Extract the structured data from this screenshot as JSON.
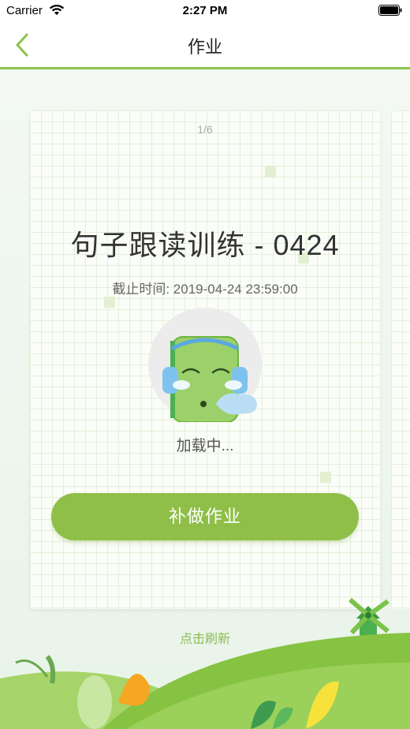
{
  "status_bar": {
    "carrier": "Carrier",
    "time": "2:27 PM"
  },
  "nav": {
    "title": "作业"
  },
  "card": {
    "page_indicator": "1/6",
    "title": "句子跟读训练 - 0424",
    "deadline": "截止时间: 2019-04-24 23:59:00",
    "loading_text": "加载中...",
    "makeup_button_label": "补做作业"
  },
  "refresh_label": "点击刷新",
  "colors": {
    "accent": "#8bc34a",
    "button": "#8fbf48"
  }
}
